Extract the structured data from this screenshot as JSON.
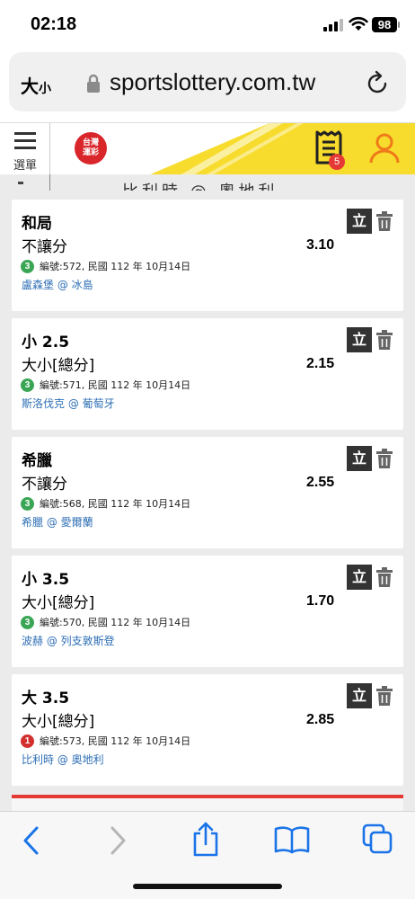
{
  "status_bar": {
    "time": "02:18",
    "battery": "98"
  },
  "address_bar": {
    "text_size_label_big": "大",
    "text_size_label_small": "小",
    "url": "sportslottery.com.tw"
  },
  "site_header": {
    "menu_label": "選單",
    "logo_text_line1": "台灣",
    "logo_text_line2": "運彩",
    "betslip_count": "5",
    "accent_color": "#f7dc2d",
    "logo_color": "#d9262b"
  },
  "scrolled_header_text": "比利時 @ 奧地利",
  "bet_cards": [
    {
      "selection": "和局",
      "bet_type": "不讓分",
      "odds": "3.10",
      "sport_code": "3",
      "sport_code_color": "#3aa655",
      "info": "編號:572, 民國 112 年 10月14日",
      "match": "盧森堡 @ 冰島",
      "single_label": "立"
    },
    {
      "selection": "小 2.5",
      "bet_type": "大小[總分]",
      "odds": "2.15",
      "sport_code": "3",
      "sport_code_color": "#3aa655",
      "info": "編號:571, 民國 112 年 10月14日",
      "match": "斯洛伐克 @ 葡萄牙",
      "single_label": "立"
    },
    {
      "selection": "希臘",
      "bet_type": "不讓分",
      "odds": "2.55",
      "sport_code": "3",
      "sport_code_color": "#3aa655",
      "info": "編號:568, 民國 112 年 10月14日",
      "match": "希臘 @ 愛爾蘭",
      "single_label": "立"
    },
    {
      "selection": "小 3.5",
      "bet_type": "大小[總分]",
      "odds": "1.70",
      "sport_code": "3",
      "sport_code_color": "#3aa655",
      "info": "編號:570, 民國 112 年 10月14日",
      "match": "波赫 @ 列支敦斯登",
      "single_label": "立"
    },
    {
      "selection": "大 3.5",
      "bet_type": "大小[總分]",
      "odds": "2.85",
      "sport_code": "1",
      "sport_code_color": "#d32f2f",
      "info": "編號:573, 民國 112 年 10月14日",
      "match": "比利時 @ 奧地利",
      "single_label": "立"
    }
  ],
  "toolbar": {
    "icons": [
      "back-icon",
      "forward-icon",
      "share-icon",
      "bookmarks-icon",
      "tabs-icon"
    ],
    "active_color": "#1a73e8"
  }
}
